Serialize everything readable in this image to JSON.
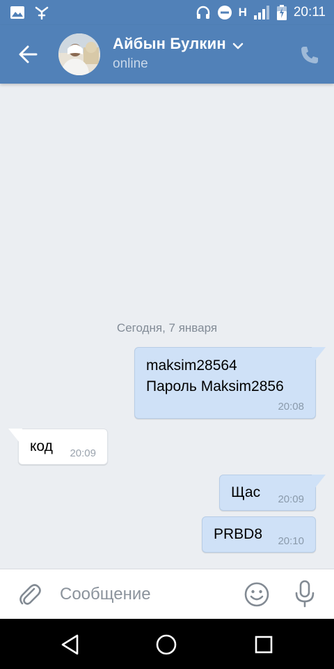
{
  "status_bar": {
    "time": "20:11",
    "network": "H"
  },
  "header": {
    "contact_name": "Айбын Булкин",
    "status": "online"
  },
  "chat": {
    "date_separator": "Сегодня, 7 января",
    "messages": [
      {
        "direction": "out",
        "text": "maksim28564\nПароль Maksim2856",
        "time": "20:08"
      },
      {
        "direction": "in",
        "text": "код",
        "time": "20:09"
      },
      {
        "direction": "out",
        "text": "Щас",
        "time": "20:09"
      },
      {
        "direction": "out",
        "text": "PRBD8",
        "time": "20:10"
      }
    ]
  },
  "input": {
    "placeholder": "Сообщение"
  },
  "colors": {
    "header": "#5181b8",
    "background": "#ebeef2",
    "outgoing_bubble": "#cfe1f7",
    "incoming_bubble": "#ffffff"
  },
  "icons": {
    "status_bar": [
      "image-icon",
      "app-notification-icon",
      "headphones-icon",
      "do-not-disturb-icon",
      "signal-icon",
      "battery-charging-icon"
    ],
    "header": [
      "back-arrow-icon",
      "chevron-down-icon",
      "phone-icon"
    ],
    "input_bar": [
      "paperclip-icon",
      "emoji-icon",
      "microphone-icon"
    ],
    "nav_bar": [
      "nav-back-icon",
      "nav-home-icon",
      "nav-recents-icon"
    ]
  }
}
